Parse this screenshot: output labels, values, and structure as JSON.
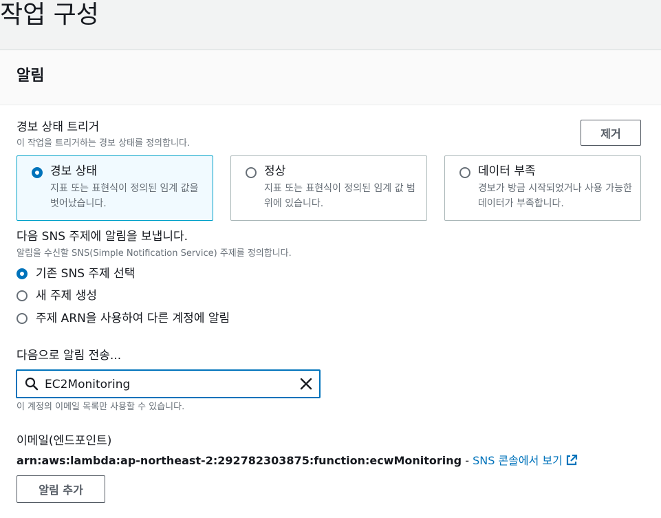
{
  "page": {
    "title": "작업 구성"
  },
  "panel": {
    "title": "알림"
  },
  "trigger": {
    "label": "경보 상태 트리거",
    "description": "이 작업을 트리거하는 경보 상태를 정의합니다.",
    "remove_label": "제거",
    "tiles": [
      {
        "title": "경보 상태",
        "desc": "지표 또는 표현식이 정의된 임계 값을 벗어났습니다.",
        "selected": true
      },
      {
        "title": "정상",
        "desc": "지표 또는 표현식이 정의된 임계 값 범위에 있습니다.",
        "selected": false
      },
      {
        "title": "데이터 부족",
        "desc": "경보가 방금 시작되었거나 사용 가능한 데이터가 부족합니다.",
        "selected": false
      }
    ]
  },
  "sns": {
    "label": "다음 SNS 주제에 알림을 보냅니다.",
    "description": "알림을 수신할 SNS(Simple Notification Service) 주제를 정의합니다.",
    "options": [
      {
        "label": "기존 SNS 주제 선택",
        "selected": true
      },
      {
        "label": "새 주제 생성",
        "selected": false
      },
      {
        "label": "주제 ARN을 사용하여 다른 계정에 알림",
        "selected": false
      }
    ]
  },
  "send_to": {
    "label": "다음으로 알림 전송...",
    "value": "EC2Monitoring",
    "hint": "이 계정의 이메일 목록만 사용할 수 있습니다."
  },
  "endpoint": {
    "label": "이메일(엔드포인트)",
    "arn": "arn:aws:lambda:ap-northeast-2:292782303875:function:ecwMonitoring",
    "separator": " - ",
    "link": "SNS 콘솔에서 보기"
  },
  "add_notification_label": "알림 추가",
  "colors": {
    "accent": "#0073bb",
    "selected_tile_bg": "#f1faff",
    "selected_tile_border": "#00a1c9"
  }
}
